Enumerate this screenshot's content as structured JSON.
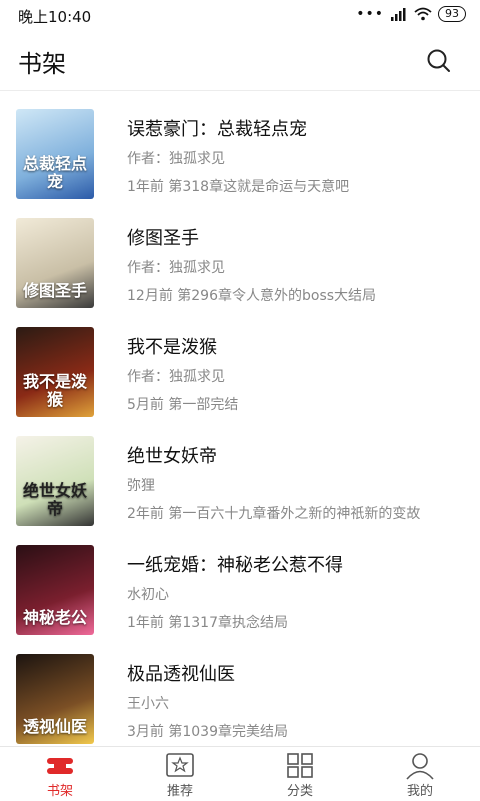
{
  "status_bar": {
    "time": "晚上10:40",
    "battery": "93"
  },
  "header": {
    "title": "书架"
  },
  "books": [
    {
      "title": "误惹豪门：总裁轻点宠",
      "author": "作者：独孤求见",
      "latest": "1年前 第318章这就是命运与天意吧",
      "cover_text": "总裁轻点宠",
      "cover_colors": [
        "#cfe7f6",
        "#7fb0dc",
        "#2b5aa8"
      ]
    },
    {
      "title": "修图圣手",
      "author": "作者：独孤求见",
      "latest": "12月前 第296章令人意外的boss大结局",
      "cover_text": "修图圣手",
      "cover_colors": [
        "#f1ead8",
        "#c9bfa6",
        "#3a3a3a"
      ]
    },
    {
      "title": "我不是泼猴",
      "author": "作者：独孤求见",
      "latest": "5月前 第一部完结",
      "cover_text": "我不是泼猴",
      "cover_colors": [
        "#2b1b14",
        "#8a2a16",
        "#e0a33a"
      ]
    },
    {
      "title": "绝世女妖帝",
      "author": "弥狸",
      "latest": "2年前 第一百六十九章番外之新的神祇新的变故",
      "cover_text": "绝世女妖帝",
      "cover_colors": [
        "#f5f2e8",
        "#cfe0b8",
        "#333333"
      ]
    },
    {
      "title": "一纸宠婚：神秘老公惹不得",
      "author": "水初心",
      "latest": "1年前 第1317章执念结局",
      "cover_text": "神秘老公",
      "cover_colors": [
        "#2a0f14",
        "#7a1f2e",
        "#f06a9a"
      ]
    },
    {
      "title": "极品透视仙医",
      "author": "王小六",
      "latest": "3月前 第1039章完美结局",
      "cover_text": "透视仙医",
      "cover_colors": [
        "#1c1410",
        "#7b4f25",
        "#f2c94c"
      ]
    }
  ],
  "tabs": [
    {
      "label": "书架",
      "icon": "bookshelf-icon",
      "active": true
    },
    {
      "label": "推荐",
      "icon": "recommend-icon",
      "active": false
    },
    {
      "label": "分类",
      "icon": "category-icon",
      "active": false
    },
    {
      "label": "我的",
      "icon": "profile-icon",
      "active": false
    }
  ],
  "colors": {
    "accent": "#e02929",
    "text_primary": "#111111",
    "text_secondary": "#888888"
  }
}
